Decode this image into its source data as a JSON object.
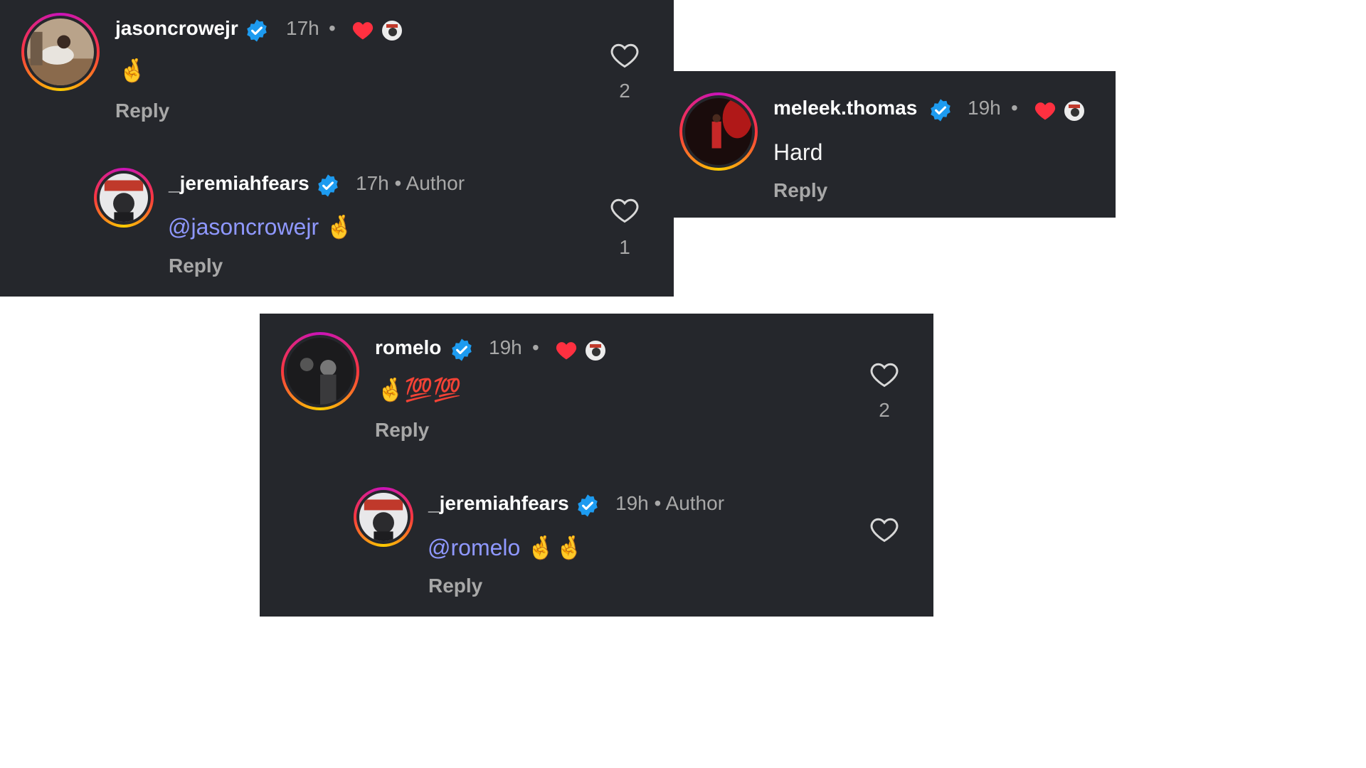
{
  "panels": [
    {
      "comment": {
        "username": "jasoncrowejr",
        "time": "17h",
        "separator": "•",
        "text": "🤞",
        "reply_label": "Reply",
        "like_count": "2"
      },
      "reply": {
        "username": "_jeremiahfears",
        "meta": "17h • Author",
        "mention": "@jasoncrowejr",
        "text": "🤞",
        "reply_label": "Reply",
        "like_count": "1"
      }
    },
    {
      "comment": {
        "username": "meleek.thomas",
        "time": "19h",
        "separator": "•",
        "text": "Hard",
        "reply_label": "Reply"
      }
    },
    {
      "comment": {
        "username": "romelo",
        "time": "19h",
        "separator": "•",
        "text": "🤞💯💯",
        "reply_label": "Reply",
        "like_count": "2"
      },
      "reply": {
        "username": "_jeremiahfears",
        "meta": "19h • Author",
        "mention": "@romelo",
        "text": "🤞🤞",
        "reply_label": "Reply"
      }
    }
  ],
  "colors": {
    "panel_bg": "#25272c",
    "verified_blue": "#1d9bf0",
    "heart_red": "#ff3040",
    "mention_blue": "#8f98ff",
    "muted_text": "#a8a8a8"
  },
  "icons": [
    "verified-badge-icon",
    "liked-by-creator-heart-icon",
    "creator-avatar-badge-icon",
    "heart-outline-icon"
  ]
}
